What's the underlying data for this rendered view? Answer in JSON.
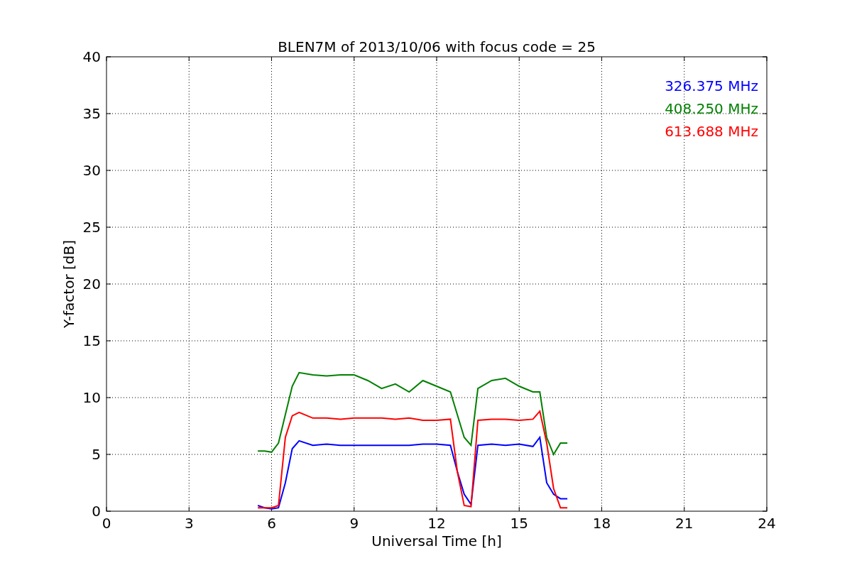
{
  "figure": {
    "chart_data": {
      "type": "line",
      "title": "BLEN7M of 2013/10/06 with focus code = 25",
      "xlabel": "Universal Time [h]",
      "ylabel": "Y-factor [dB]",
      "x": [
        5.5,
        5.75,
        6,
        6.25,
        6.5,
        6.75,
        7,
        7.5,
        8,
        8.5,
        9,
        9.5,
        10,
        10.5,
        11,
        11.5,
        12,
        12.5,
        12.75,
        13,
        13.25,
        13.5,
        14,
        14.5,
        15,
        15.5,
        15.75,
        16,
        16.25,
        16.5,
        16.75
      ],
      "series": [
        {
          "name": "326.375 MHz",
          "color": "#0000ff",
          "values": [
            0.5,
            0.3,
            0.2,
            0.3,
            2.5,
            5.5,
            6.2,
            5.8,
            5.9,
            5.8,
            5.8,
            5.8,
            5.8,
            5.8,
            5.8,
            5.9,
            5.9,
            5.8,
            3.5,
            1.5,
            0.6,
            5.8,
            5.9,
            5.8,
            5.9,
            5.7,
            6.5,
            2.5,
            1.5,
            1.1,
            1.1
          ]
        },
        {
          "name": "408.250 MHz",
          "color": "#008000",
          "values": [
            5.3,
            5.3,
            5.2,
            6.0,
            8.5,
            11.0,
            12.2,
            12.0,
            11.9,
            12.0,
            12.0,
            11.5,
            10.8,
            11.2,
            10.5,
            11.5,
            11.0,
            10.5,
            8.5,
            6.5,
            5.8,
            10.8,
            11.5,
            11.7,
            11.0,
            10.5,
            10.5,
            6.5,
            5.0,
            6.0,
            6.0
          ]
        },
        {
          "name": "613.688 MHz",
          "color": "#ff0000",
          "values": [
            0.3,
            0.3,
            0.3,
            0.5,
            6.5,
            8.4,
            8.7,
            8.2,
            8.2,
            8.1,
            8.2,
            8.2,
            8.2,
            8.1,
            8.2,
            8.0,
            8.0,
            8.1,
            3.5,
            0.5,
            0.4,
            8.0,
            8.1,
            8.1,
            8.0,
            8.1,
            8.8,
            6.0,
            2.0,
            0.3,
            0.3
          ]
        }
      ],
      "grid": true,
      "xlim": [
        0,
        24
      ],
      "ylim": [
        0,
        40
      ],
      "xticks": [
        0,
        3,
        6,
        9,
        12,
        15,
        18,
        21,
        24
      ],
      "yticks": [
        0,
        5,
        10,
        15,
        20,
        25,
        30,
        35,
        40
      ]
    }
  }
}
